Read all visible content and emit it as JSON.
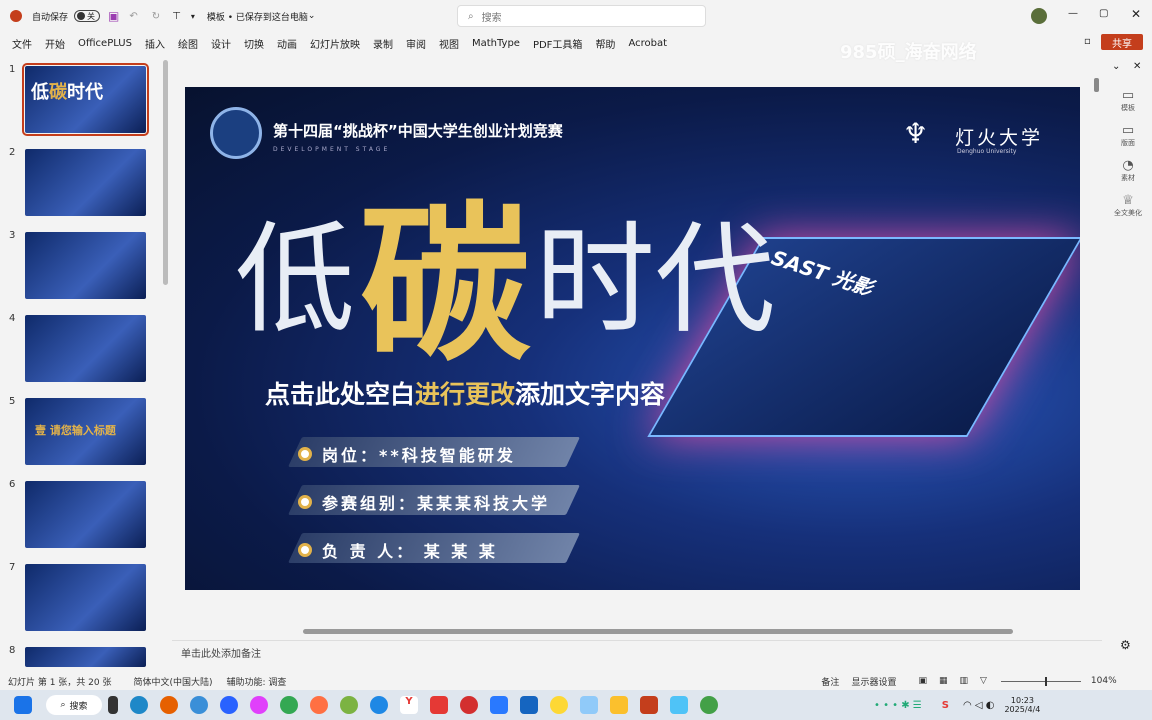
{
  "titlebar": {
    "autosave_label": "自动保存",
    "autosave_state": "关",
    "doc_title": "模板 • 已保存到这台电脑",
    "search_placeholder": "搜索"
  },
  "menu": [
    "文件",
    "开始",
    "OfficePLUS",
    "插入",
    "绘图",
    "设计",
    "切换",
    "动画",
    "幻灯片放映",
    "录制",
    "审阅",
    "视图",
    "MathType",
    "PDF工具箱",
    "帮助",
    "Acrobat"
  ],
  "share_label": "共享",
  "watermark": "985硕_海奋网络",
  "thumbnails": [
    {
      "num": "1"
    },
    {
      "num": "2"
    },
    {
      "num": "3"
    },
    {
      "num": "4"
    },
    {
      "num": "5",
      "text": "壹 请您输入标题"
    },
    {
      "num": "6"
    },
    {
      "num": "7"
    },
    {
      "num": "8"
    }
  ],
  "slide": {
    "competition": "第十四届“挑战杯”中国大学生创业计划竞赛",
    "stage": "DEVELOPMENT STAGE",
    "university": "灯火大学",
    "university_en": "Denghuo University",
    "title_a": "低",
    "title_b": "碳",
    "title_c": "时代",
    "chip_label": "SAST 光影",
    "subtitle_a": "点击此处空白",
    "subtitle_b": "进行更改",
    "subtitle_c": "添加文字内容",
    "items": [
      "岗位：**科技智能研发",
      "参赛组别：某某某科技大学",
      "负 责 人： 某 某 某"
    ]
  },
  "right_panel": [
    "模板",
    "版面",
    "素材",
    "全文美化"
  ],
  "notes_placeholder": "单击此处添加备注",
  "status": {
    "slide_info": "幻灯片 第 1 张，共 20 张",
    "language": "简体中文(中国大陆)",
    "accessibility": "辅助功能: 调查",
    "notes": "备注",
    "display": "显示器设置",
    "zoom": "104%"
  },
  "taskbar": {
    "search": "搜索",
    "time": "10:23",
    "date": "2025/4/4"
  },
  "colors": {
    "accent": "#c43e1c",
    "gold": "#e2b24a"
  }
}
